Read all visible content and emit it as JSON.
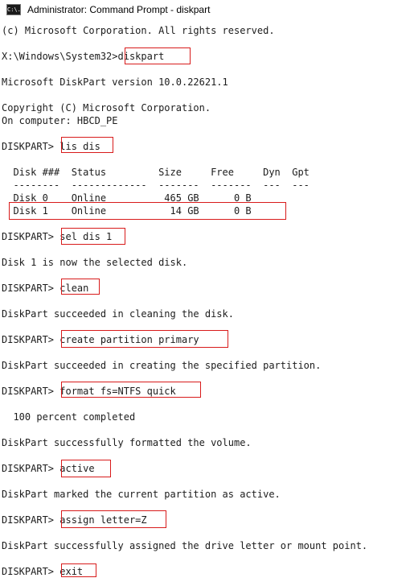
{
  "window": {
    "title": "Administrator: Command Prompt - diskpart",
    "icon_text": "C:\\."
  },
  "console": {
    "lines": [
      "(c) Microsoft Corporation. All rights reserved.",
      "",
      "X:\\Windows\\System32>diskpart",
      "",
      "Microsoft DiskPart version 10.0.22621.1",
      "",
      "Copyright (C) Microsoft Corporation.",
      "On computer: HBCD_PE",
      "",
      "DISKPART> lis dis",
      "",
      "  Disk ###  Status         Size     Free     Dyn  Gpt",
      "  --------  -------------  -------  -------  ---  ---",
      "  Disk 0    Online          465 GB      0 B",
      "  Disk 1    Online           14 GB      0 B",
      "",
      "DISKPART> sel dis 1",
      "",
      "Disk 1 is now the selected disk.",
      "",
      "DISKPART> clean",
      "",
      "DiskPart succeeded in cleaning the disk.",
      "",
      "DISKPART> create partition primary",
      "",
      "DiskPart succeeded in creating the specified partition.",
      "",
      "DISKPART> format fs=NTFS quick",
      "",
      "  100 percent completed",
      "",
      "DiskPart successfully formatted the volume.",
      "",
      "DISKPART> active",
      "",
      "DiskPart marked the current partition as active.",
      "",
      "DISKPART> assign letter=Z",
      "",
      "DiskPart successfully assigned the drive letter or mount point.",
      "",
      "DISKPART> exit"
    ]
  },
  "highlight_color": "#d81b1b"
}
